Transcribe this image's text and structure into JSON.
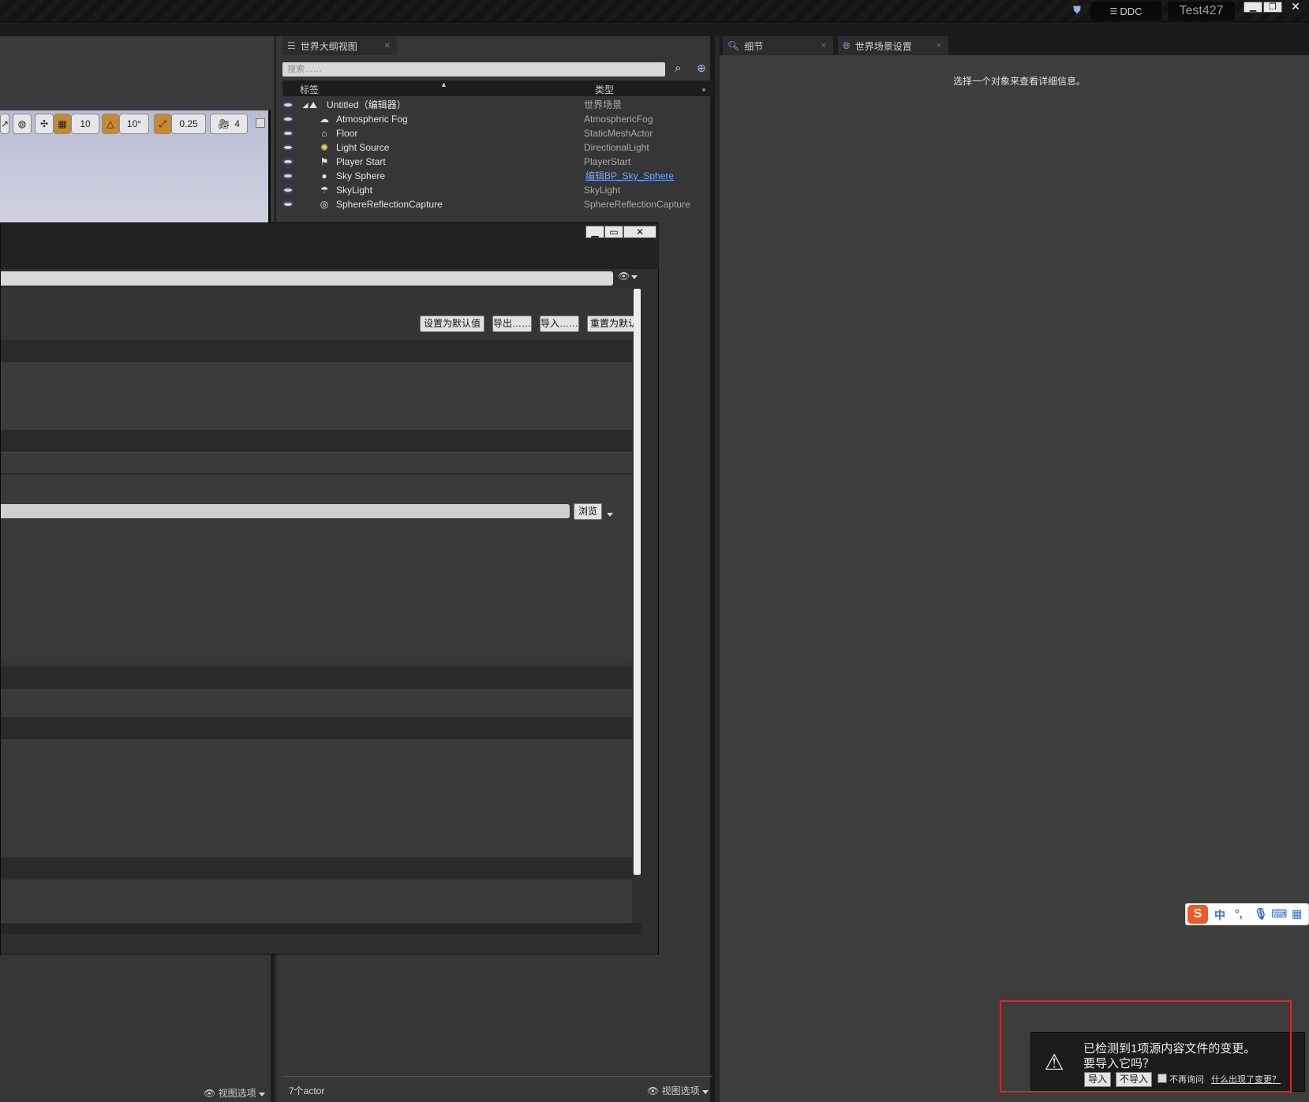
{
  "titlebar": {
    "ddc_label": "DDC",
    "project_name": "Test427"
  },
  "viewport_toolbar": {
    "grid_snap": "10",
    "rotation_snap": "10°",
    "scale_snap": "0.25",
    "camera_speed": "4"
  },
  "outliner": {
    "tab_label": "世界大纲视图",
    "search_placeholder": "搜索……",
    "col_label": "标签",
    "col_type": "类型",
    "rows": [
      {
        "label": "Untitled（编辑器）",
        "type": "世界场景"
      },
      {
        "label": "Atmospheric Fog",
        "type": "AtmosphericFog"
      },
      {
        "label": "Floor",
        "type": "StaticMeshActor"
      },
      {
        "label": "Light Source",
        "type": "DirectionalLight"
      },
      {
        "label": "Player Start",
        "type": "PlayerStart"
      },
      {
        "label": "Sky Sphere",
        "type": "编辑BP_Sky_Sphere"
      },
      {
        "label": "SkyLight",
        "type": "SkyLight"
      },
      {
        "label": "SphereReflectionCapture",
        "type": "SphereReflectionCapture"
      }
    ],
    "actor_count": "7个actor",
    "view_options": "视图选项"
  },
  "left_panel": {
    "view_options": "视图选项"
  },
  "dialog": {
    "btn_set_default": "设置为默认值",
    "btn_export": "导出……",
    "btn_import": "导入……",
    "btn_reset_default": "重置为默认",
    "btn_browse": "浏览"
  },
  "details": {
    "tab_details": "细节",
    "tab_world_settings": "世界场景设置",
    "empty_message": "选择一个对象来查看详细信息。"
  },
  "ime": {
    "mode": "中"
  },
  "notification": {
    "line1": "已检测到1项源内容文件的变更。",
    "line2": "要导入它吗？",
    "btn_import": "导入",
    "btn_no_import": "不导入",
    "dont_ask": "不再询问",
    "why_link": "什么出现了变更？"
  }
}
